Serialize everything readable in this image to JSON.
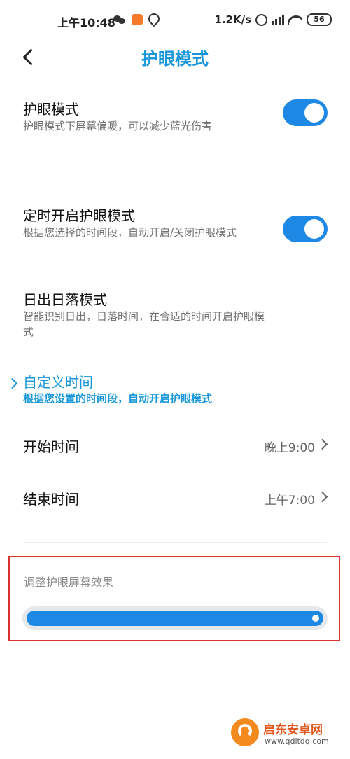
{
  "status_bar": {
    "time": "上午10:48",
    "speed": "1.2K/s",
    "battery": "56"
  },
  "header": {
    "title": "护眼模式"
  },
  "eye_mode": {
    "title": "护眼模式",
    "desc": "护眼模式下屏幕偏暖，可以减少蓝光伤害",
    "enabled": true
  },
  "scheduled": {
    "title": "定时开启护眼模式",
    "desc": "根据您选择的时间段，自动开启/关闭护眼模式",
    "enabled": true
  },
  "sunrise_mode": {
    "title": "日出日落模式",
    "desc": "智能识别日出，日落时间，在合适的时间开启护眼模式"
  },
  "custom_mode": {
    "title": "自定义时间",
    "desc": "根据您设置的时间段，自动开启护眼模式"
  },
  "start_time": {
    "label": "开始时间",
    "value": "晚上9:00"
  },
  "end_time": {
    "label": "结束时间",
    "value": "上午7:00"
  },
  "adjust": {
    "label": "调整护眼屏幕效果",
    "level": 1.0
  },
  "watermark": {
    "text": "启东安卓网",
    "url": "www.qdltdq.com"
  },
  "colors": {
    "accent": "#1797d9",
    "toggle_on": "#1e88e5",
    "highlight_border": "#d9342b"
  }
}
